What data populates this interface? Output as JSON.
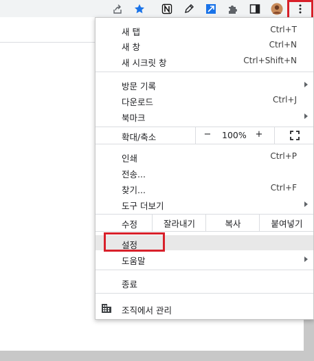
{
  "toolbar": {
    "icons": [
      "share-icon",
      "bookmark-star-icon",
      "notion-icon",
      "pencil-icon",
      "extension-blue-icon",
      "puzzle-icon",
      "side-panel-icon",
      "profile-avatar",
      "more-vert-icon"
    ]
  },
  "colors": {
    "highlight_box": "#d8202a",
    "accent_star": "#1a73e8",
    "menu_hover": "#e8e8e8"
  },
  "menu": {
    "new_tab": {
      "label": "새 탭",
      "shortcut": "Ctrl+T"
    },
    "new_window": {
      "label": "새 창",
      "shortcut": "Ctrl+N"
    },
    "new_incognito": {
      "label": "새 시크릿 창",
      "shortcut": "Ctrl+Shift+N"
    },
    "history": {
      "label": "방문 기록"
    },
    "downloads": {
      "label": "다운로드",
      "shortcut": "Ctrl+J"
    },
    "bookmarks": {
      "label": "북마크"
    },
    "zoom": {
      "label": "확대/축소",
      "minus": "−",
      "value": "100%",
      "plus": "+"
    },
    "print": {
      "label": "인쇄",
      "shortcut": "Ctrl+P"
    },
    "cast": {
      "label": "전송..."
    },
    "find": {
      "label": "찾기...",
      "shortcut": "Ctrl+F"
    },
    "more_tools": {
      "label": "도구 더보기"
    },
    "edit": {
      "label": "수정",
      "cut": "잘라내기",
      "copy": "복사",
      "paste": "붙여넣기"
    },
    "settings": {
      "label": "설정"
    },
    "help": {
      "label": "도움말"
    },
    "exit": {
      "label": "종료"
    },
    "managed": {
      "label": "조직에서 관리"
    }
  }
}
